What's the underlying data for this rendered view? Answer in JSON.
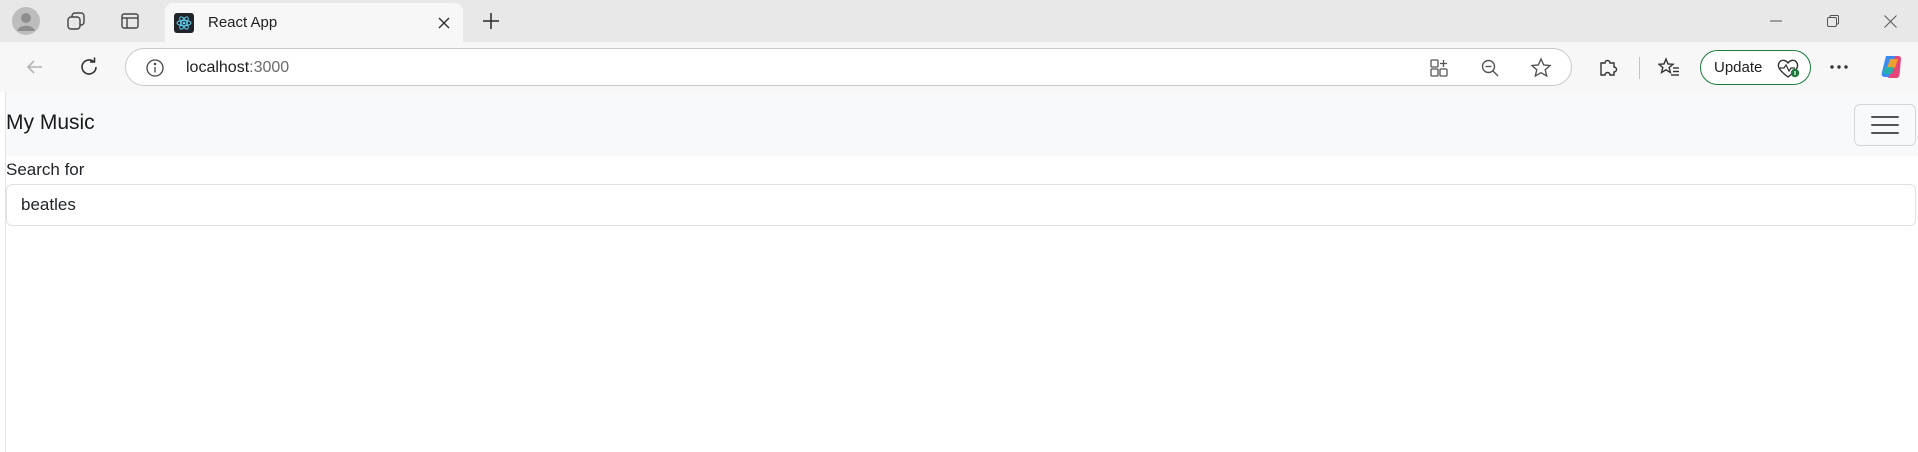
{
  "browser": {
    "tab": {
      "title": "React App",
      "favicon": "react-logo-icon"
    },
    "address": {
      "host": "localhost",
      "port": ":3000"
    },
    "toolbar": {
      "update_label": "Update"
    },
    "colors": {
      "update_border": "#1b7a3a",
      "tabstrip_bg": "#e8e8e8",
      "toolbar_bg": "#f7f7f7"
    }
  },
  "app": {
    "brand": "My Music",
    "search": {
      "label": "Search for",
      "value": "beatles"
    },
    "colors": {
      "navbar_bg": "#f8f9fa",
      "text": "#212529"
    }
  }
}
